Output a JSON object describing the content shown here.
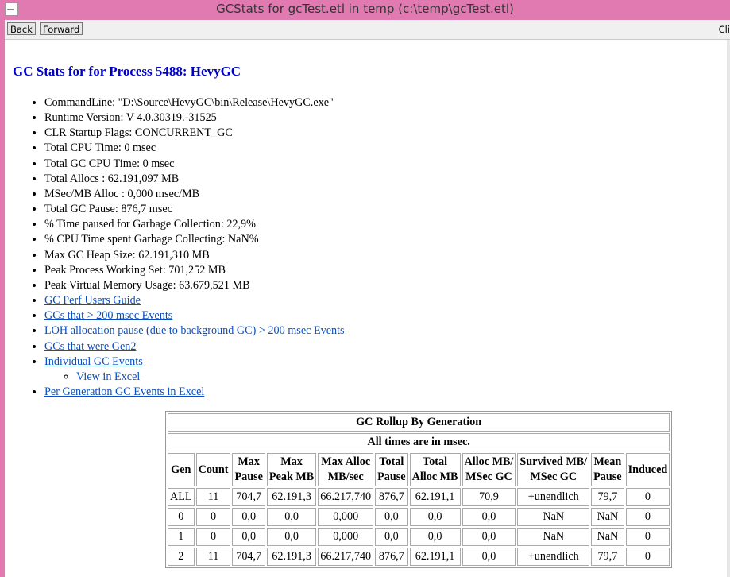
{
  "window": {
    "title": "GCStats for gcTest.etl in temp (c:\\temp\\gcTest.etl)"
  },
  "toolbar": {
    "back_label": "Back",
    "forward_label": "Forward",
    "right_text": "Cli"
  },
  "page": {
    "heading": "GC Stats for for Process 5488: HevyGC",
    "stats": [
      "CommandLine: \"D:\\Source\\HevyGC\\bin\\Release\\HevyGC.exe\"",
      "Runtime Version: V 4.0.30319.-31525",
      "CLR Startup Flags: CONCURRENT_GC",
      "Total CPU Time: 0 msec",
      "Total GC CPU Time: 0 msec",
      "Total Allocs : 62.191,097 MB",
      "MSec/MB Alloc : 0,000 msec/MB",
      "Total GC Pause: 876,7 msec",
      "% Time paused for Garbage Collection: 22,9%",
      "% CPU Time spent Garbage Collecting: NaN%",
      "Max GC Heap Size: 62.191,310 MB",
      "Peak Process Working Set: 701,252 MB",
      "Peak Virtual Memory Usage: 63.679,521 MB"
    ],
    "links": {
      "perf_guide": "GC Perf Users Guide",
      "gcs_200": "GCs that > 200 msec Events",
      "loh_pause": "LOH allocation pause (due to background GC) > 200 msec Events",
      "gen2": "GCs that were Gen2",
      "individual": "Individual GC Events",
      "view_excel": "View in Excel",
      "per_gen": "Per Generation GC Events in Excel"
    }
  },
  "rollup": {
    "title": "GC Rollup By Generation",
    "subtitle": "All times are in msec.",
    "headers": [
      [
        "Gen"
      ],
      [
        "Count"
      ],
      [
        "Max",
        "Pause"
      ],
      [
        "Max",
        "Peak MB"
      ],
      [
        "Max Alloc",
        "MB/sec"
      ],
      [
        "Total",
        "Pause"
      ],
      [
        "Total",
        "Alloc MB"
      ],
      [
        "Alloc MB/",
        "MSec GC"
      ],
      [
        "Survived MB/",
        "MSec GC"
      ],
      [
        "Mean",
        "Pause"
      ],
      [
        "Induced"
      ]
    ],
    "rows": [
      [
        "ALL",
        "11",
        "704,7",
        "62.191,3",
        "66.217,740",
        "876,7",
        "62.191,1",
        "70,9",
        "+unendlich",
        "79,7",
        "0"
      ],
      [
        "0",
        "0",
        "0,0",
        "0,0",
        "0,000",
        "0,0",
        "0,0",
        "0,0",
        "NaN",
        "NaN",
        "0"
      ],
      [
        "1",
        "0",
        "0,0",
        "0,0",
        "0,000",
        "0,0",
        "0,0",
        "0,0",
        "NaN",
        "NaN",
        "0"
      ],
      [
        "2",
        "11",
        "704,7",
        "62.191,3",
        "66.217,740",
        "876,7",
        "62.191,1",
        "0,0",
        "+unendlich",
        "79,7",
        "0"
      ]
    ]
  },
  "colors": {
    "frame": "#e07ab1",
    "heading": "#0000cc",
    "link": "#0b4fbf"
  }
}
